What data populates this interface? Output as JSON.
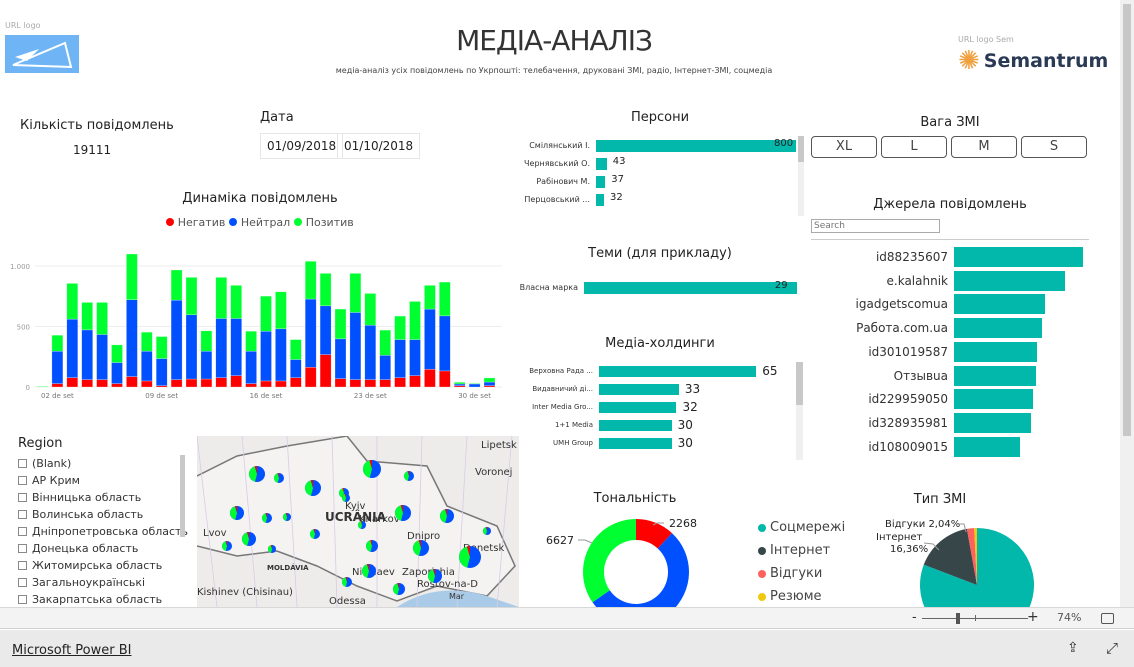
{
  "header": {
    "title": "МЕДІА-АНАЛІЗ",
    "subtitle": "медіа-аналіз усіх повідомлень по Укрпошті: телебачення, друковані ЗМІ, радіо, Інтернет-ЗМІ, соцмедіа",
    "logo_left_caption": "URL logo",
    "logo_right_caption": "URL logo Sem",
    "logo_right_text": "Semantrum"
  },
  "kpi": {
    "label": "Кількість повідомлень",
    "value": "19111"
  },
  "date": {
    "label": "Дата",
    "from": "01/09/2018",
    "to": "01/10/2018"
  },
  "weight": {
    "title": "Вага ЗМІ",
    "buttons": [
      "XL",
      "L",
      "M",
      "S"
    ]
  },
  "colors": {
    "negative": "#ff0000",
    "neutral": "#0050ff",
    "positive": "#00ff30",
    "teal": "#01b8aa",
    "internet": "#374649",
    "reviews": "#fd625e",
    "resume": "#f2c80f"
  },
  "chart_data": [
    {
      "type": "bar",
      "stacked": true,
      "title": "Динаміка повідомлень",
      "legend_position": "top",
      "yticks": [
        "0",
        "500",
        "1.000"
      ],
      "ylim": [
        0,
        1150
      ],
      "xticks": [
        "02 de set",
        "09 de set",
        "16 de set",
        "23 de set",
        "30 de set"
      ],
      "xtick_index": [
        1,
        8,
        15,
        22,
        29
      ],
      "grid": true,
      "categories": [
        "01 de set",
        "02 de set",
        "03 de set",
        "04 de set",
        "05 de set",
        "06 de set",
        "07 de set",
        "08 de set",
        "09 de set",
        "10 de set",
        "11 de set",
        "12 de set",
        "13 de set",
        "14 de set",
        "15 de set",
        "16 de set",
        "17 de set",
        "18 de set",
        "19 de set",
        "20 de set",
        "21 de set",
        "22 de set",
        "23 de set",
        "24 de set",
        "25 de set",
        "26 de set",
        "27 de set",
        "28 de set",
        "29 de set",
        "30 de set",
        "01 de out"
      ],
      "series": [
        {
          "name": "Негатив",
          "values": [
            0,
            28,
            77,
            61,
            61,
            28,
            86,
            50,
            11,
            61,
            66,
            66,
            77,
            94,
            28,
            50,
            50,
            77,
            163,
            268,
            69,
            61,
            61,
            61,
            77,
            94,
            146,
            133,
            11,
            0,
            11
          ]
        },
        {
          "name": "Нейтрал",
          "values": [
            0,
            268,
            484,
            411,
            373,
            174,
            635,
            246,
            224,
            657,
            531,
            230,
            489,
            472,
            268,
            411,
            431,
            150,
            564,
            403,
            329,
            555,
            450,
            201,
            315,
            298,
            498,
            455,
            14,
            25,
            30
          ]
        },
        {
          "name": "Позитив",
          "values": [
            5,
            132,
            295,
            227,
            265,
            146,
            378,
            157,
            182,
            249,
            309,
            168,
            340,
            274,
            165,
            290,
            306,
            165,
            312,
            268,
            246,
            323,
            262,
            208,
            194,
            315,
            196,
            279,
            14,
            5,
            34
          ]
        }
      ]
    },
    {
      "type": "bar",
      "orientation": "horizontal",
      "title": "Персони",
      "categories": [
        "Смілянський І.",
        "Чернявський О.",
        "Рабінович М.",
        "Перцовський ..."
      ],
      "values": [
        800,
        43,
        37,
        32
      ]
    },
    {
      "type": "bar",
      "orientation": "horizontal",
      "title": "Теми (для прикладу)",
      "categories": [
        "Власна марка"
      ],
      "values": [
        29
      ]
    },
    {
      "type": "bar",
      "orientation": "horizontal",
      "title": "Медіа-холдинги",
      "categories": [
        "Верховна Рада ...",
        "Видавничий ді...",
        "Inter Media Gro...",
        "1+1 Media",
        "UMH Group"
      ],
      "values": [
        65,
        33,
        32,
        30,
        30
      ]
    },
    {
      "type": "bar",
      "orientation": "horizontal",
      "title": "Джерела повідомлень",
      "categories": [
        "id88235607",
        "e.kalahnik",
        "igadgetscomua",
        "Работа.com.ua",
        "id301019587",
        "Отзывua",
        "id229959050",
        "id328935981",
        "id108009015"
      ],
      "values": [
        387,
        332,
        272,
        263,
        250,
        247,
        237,
        232,
        199
      ]
    },
    {
      "type": "pie",
      "donut": true,
      "title": "Тональність",
      "labels": [
        "Негатив",
        "Нейтрал",
        "Позитив"
      ],
      "values": [
        2268,
        10216,
        6627
      ],
      "data_labels": [
        "2268",
        "",
        "6627"
      ]
    },
    {
      "type": "pie",
      "title": "Тип ЗМІ",
      "labels": [
        "Соцмережі",
        "Інтернет",
        "Відгуки",
        "Резюме"
      ],
      "values": [
        80.8,
        16.36,
        2.04,
        0.8
      ],
      "data_labels": [
        "",
        "Інтернет 16,36%",
        "Відгуки 2,04%",
        ""
      ]
    }
  ],
  "sources": {
    "search_placeholder": "Search"
  },
  "region": {
    "title": "Region",
    "items": [
      "(Blank)",
      "АР Крим",
      "Вінницька область",
      "Волинська область",
      "Дніпропетровська область",
      "Донецька область",
      "Житомирська область",
      "Загальноукраїнські",
      "Закарпатська область"
    ]
  },
  "map": {
    "labels": [
      "Lipetsk",
      "Voronej",
      "Kyiv",
      "UCRÂNIA",
      "Kharkov",
      "Lvov",
      "Dnipro",
      "Donetsk",
      "MOLDÁVIA",
      "Nikolaev",
      "Zaporizhia",
      "Kishinev (Chisinau)",
      "Rostov-na-D",
      "Odessa",
      "Mar"
    ]
  },
  "zoom": {
    "minus": "-",
    "plus": "+",
    "level": "74%",
    "level_value": 74
  },
  "footer": {
    "link": "Microsoft Power BI"
  }
}
